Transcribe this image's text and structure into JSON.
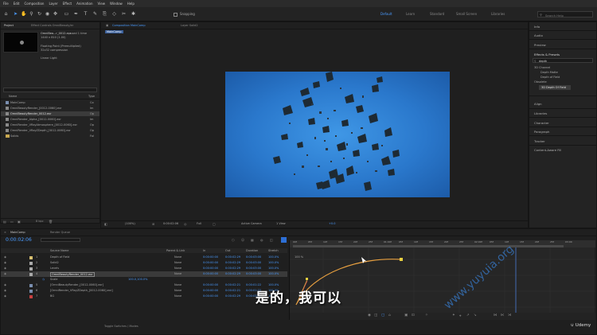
{
  "menu": [
    "File",
    "Edit",
    "Composition",
    "Layer",
    "Effect",
    "Animation",
    "View",
    "Window",
    "Help"
  ],
  "toolbar": {
    "snapping_label": "Snapping",
    "workspaces": [
      "Default",
      "Learn",
      "Standard",
      "Small Screen",
      "Libraries"
    ],
    "search_placeholder": "Search Help"
  },
  "project_panel": {
    "tab": "Project",
    "effect_controls_tab": "Effect Controls OmniBeauty/er",
    "item_name": "OmniBea...r_0012.exr",
    "item_used": ", used 1 time",
    "item_size": "1440 x 810 (1.00)",
    "item_line3": "Floating Point (Premultiplied)",
    "item_line4": "32x32 compression",
    "item_line5": "Linear Light",
    "columns": {
      "name": "Name",
      "type": "Type"
    },
    "items": [
      {
        "name": "MainComp",
        "type": "Co"
      },
      {
        "name": "OmniBeautyRender_[0012-0060].exr",
        "type": "Im"
      },
      {
        "name": "OmniBeautyRender_0012.exr",
        "type": "Op"
      },
      {
        "name": "OmniRender_Alpha_[0012-0060].exr",
        "type": "Im"
      },
      {
        "name": "OmniRender_VRayAtmosphere_[0012-0060].exr",
        "type": "Op"
      },
      {
        "name": "OmniRender_VRayZDepth_[0012-0060].exr",
        "type": "Op"
      },
      {
        "name": "Solids",
        "type": "Fol"
      }
    ],
    "bpc": "8 bpc"
  },
  "viewer": {
    "comp_tab": "Composition MainComp",
    "layer_tab": "Layer Solid2",
    "breadcrumb": "MainComp",
    "zoom": "(100%)",
    "timecode": "0:00:02:06",
    "resolution": "Full",
    "camera": "Active Camera",
    "views": "1 View",
    "exposure": "+0.0"
  },
  "right_panel": {
    "items": [
      "Info",
      "Audio",
      "Preview",
      "Effects & Presets"
    ],
    "search_value": "depth",
    "tree": [
      "3D Channel",
      "Depth Matte",
      "Depth of Field",
      "Obsolete",
      "3D Depth Of Field"
    ],
    "more_items": [
      "Align",
      "Libraries",
      "Character",
      "Paragraph",
      "Tracker",
      "Content-Aware Fill"
    ]
  },
  "timeline": {
    "comp_tab": "MainComp",
    "render_tab": "Render Queue",
    "timecode": "0:00:02:06",
    "columns": [
      "Source Name",
      "Parent & Link",
      "In",
      "Out",
      "Duration",
      "Stretch"
    ],
    "layers": [
      {
        "num": "1",
        "name": "Depth of Field",
        "parent": "None",
        "in": "0:00:00:00",
        "out": "0:00:02:29",
        "dur": "0:00:03:00",
        "stretch": "100.0%"
      },
      {
        "num": "2",
        "name": "Solid2",
        "parent": "None",
        "in": "0:00:00:00",
        "out": "0:00:02:29",
        "dur": "0:00:03:00",
        "stretch": "100.0%"
      },
      {
        "num": "3",
        "name": "Levels",
        "parent": "None",
        "in": "0:00:00:00",
        "out": "0:00:02:29",
        "dur": "0:00:03:00",
        "stretch": "100.0%"
      },
      {
        "num": "4",
        "name": "OmniBeautyRender_0012.exr",
        "parent": "None",
        "in": "0:00:00:00",
        "out": "0:00:02:29",
        "dur": "0:00:03:00",
        "stretch": "100.0%"
      },
      {
        "num": "",
        "name": "Scale",
        "parent": "",
        "in": "",
        "out": "",
        "dur": "",
        "stretch": ""
      },
      {
        "num": "5",
        "name": "[OmniBeautyRender_[0012-0060].exr]",
        "parent": "None",
        "in": "0:00:00:00",
        "out": "0:00:02:21",
        "dur": "0:00:01:22",
        "stretch": "100.0%"
      },
      {
        "num": "6",
        "name": "[OmniRender_VRayZDepth_[0012-0060].exr]",
        "parent": "None",
        "in": "0:00:00:00",
        "out": "0:00:02:21",
        "dur": "0:00:01:22",
        "stretch": "100.0%"
      },
      {
        "num": "7",
        "name": "BG",
        "parent": "None",
        "in": "0:00:00:00",
        "out": "0:00:02:29",
        "dur": "0:00:03:00",
        "stretch": "100.0%"
      }
    ],
    "scale_value": "100.0,100.0%",
    "graph_label": "100 %",
    "toggle_label": "Toggle Switches / Modes",
    "ruler": [
      "00f",
      "05f",
      "10f",
      "15f",
      "20f",
      "25f",
      "01:00f",
      "05f",
      "10f",
      "15f",
      "20f",
      "25f",
      "02:00f",
      "05f",
      "10f",
      "15f",
      "20f",
      "25f",
      "03:00"
    ]
  },
  "overlay": {
    "subtitle": "是的，我可以",
    "watermark": "www.yuyuia.org",
    "brand": "Udemy"
  }
}
